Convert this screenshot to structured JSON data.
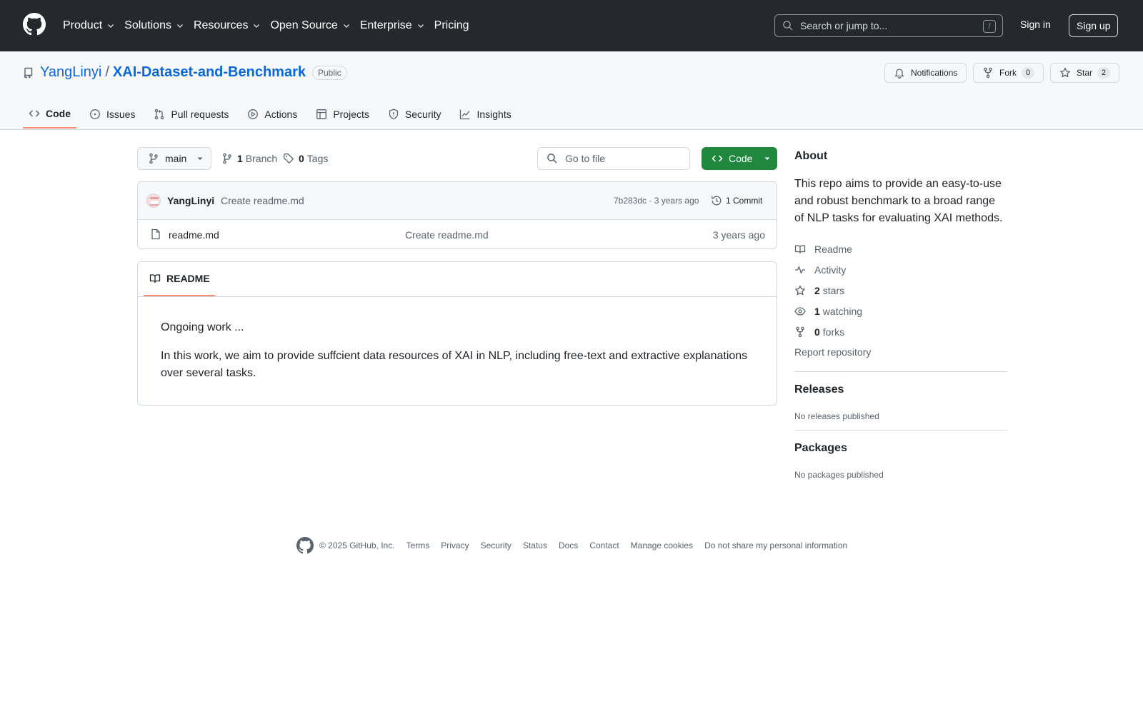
{
  "header": {
    "nav": [
      "Product",
      "Solutions",
      "Resources",
      "Open Source",
      "Enterprise",
      "Pricing"
    ],
    "search_placeholder": "Search or jump to...",
    "search_shortcut": "/",
    "sign_in": "Sign in",
    "sign_up": "Sign up"
  },
  "repo": {
    "owner": "YangLinyi",
    "separator": "/",
    "name": "XAI-Dataset-and-Benchmark",
    "visibility": "Public",
    "notifications_label": "Notifications",
    "fork_label": "Fork",
    "fork_count": "0",
    "star_label": "Star",
    "star_count": "2"
  },
  "tabs": [
    "Code",
    "Issues",
    "Pull requests",
    "Actions",
    "Projects",
    "Security",
    "Insights"
  ],
  "toolbar": {
    "branch": "main",
    "branch_count": "1",
    "branch_label": "Branch",
    "tag_count": "0",
    "tag_label": "Tags",
    "go_to_file": "Go to file",
    "code_button": "Code"
  },
  "commit": {
    "author": "YangLinyi",
    "message": "Create readme.md",
    "meta": "7b283dc · 3 years ago",
    "count": "1 Commit"
  },
  "files": [
    {
      "name": "readme.md",
      "message": "Create readme.md",
      "age": "3 years ago"
    }
  ],
  "readme": {
    "tab": "README",
    "paragraphs": [
      "Ongoing work ...",
      "In this work, we aim to provide suffcient data resources of XAI in NLP, including free-text and extractive explanations over several tasks."
    ]
  },
  "about": {
    "heading": "About",
    "description": "This repo aims to provide an easy-to-use and robust benchmark to a broad range of NLP tasks for evaluating XAI methods.",
    "readme": "Readme",
    "activity": "Activity",
    "stars_count": "2",
    "stars_label": "stars",
    "watching_count": "1",
    "watching_label": "watching",
    "forks_count": "0",
    "forks_label": "forks",
    "report": "Report repository"
  },
  "releases": {
    "heading": "Releases",
    "empty": "No releases published"
  },
  "packages": {
    "heading": "Packages",
    "empty": "No packages published"
  },
  "footer": {
    "copyright": "© 2025 GitHub, Inc.",
    "links": [
      "Terms",
      "Privacy",
      "Security",
      "Status",
      "Docs",
      "Contact",
      "Manage cookies",
      "Do not share my personal information"
    ]
  },
  "colors": {
    "header_bg": "#25292e",
    "link": "#0969da",
    "primary_button": "#1f883d",
    "tab_underline": "#fd8c73"
  }
}
